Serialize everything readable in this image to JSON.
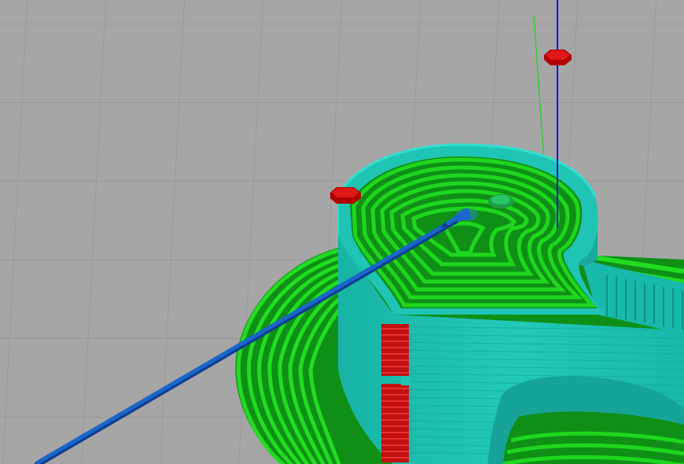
{
  "scene": {
    "background": "#a6a6a6",
    "grid_color": "#8f8f8f",
    "colors": {
      "perimeter_green": "#1fd61f",
      "perimeter_green_dark": "#0f8f16",
      "wall_cyan": "#1fc4b4",
      "wall_cyan_dark": "#128e84",
      "travel_blue": "#1a66cc",
      "retract_red": "#d81414",
      "axis_z_blue": "#1414e6",
      "axis_y_green": "#33cc33"
    },
    "objects": [
      {
        "name": "skirt-brim-layer",
        "description_icon": "toolpath-green"
      },
      {
        "name": "printed-wall",
        "description_icon": "toolpath-cyan"
      },
      {
        "name": "travel-move",
        "description_icon": "travel-line"
      },
      {
        "name": "retraction-markers",
        "description_icon": "retract-marker"
      },
      {
        "name": "z-axis",
        "description_icon": "axis-line"
      },
      {
        "name": "y-axis",
        "description_icon": "axis-line"
      }
    ]
  }
}
